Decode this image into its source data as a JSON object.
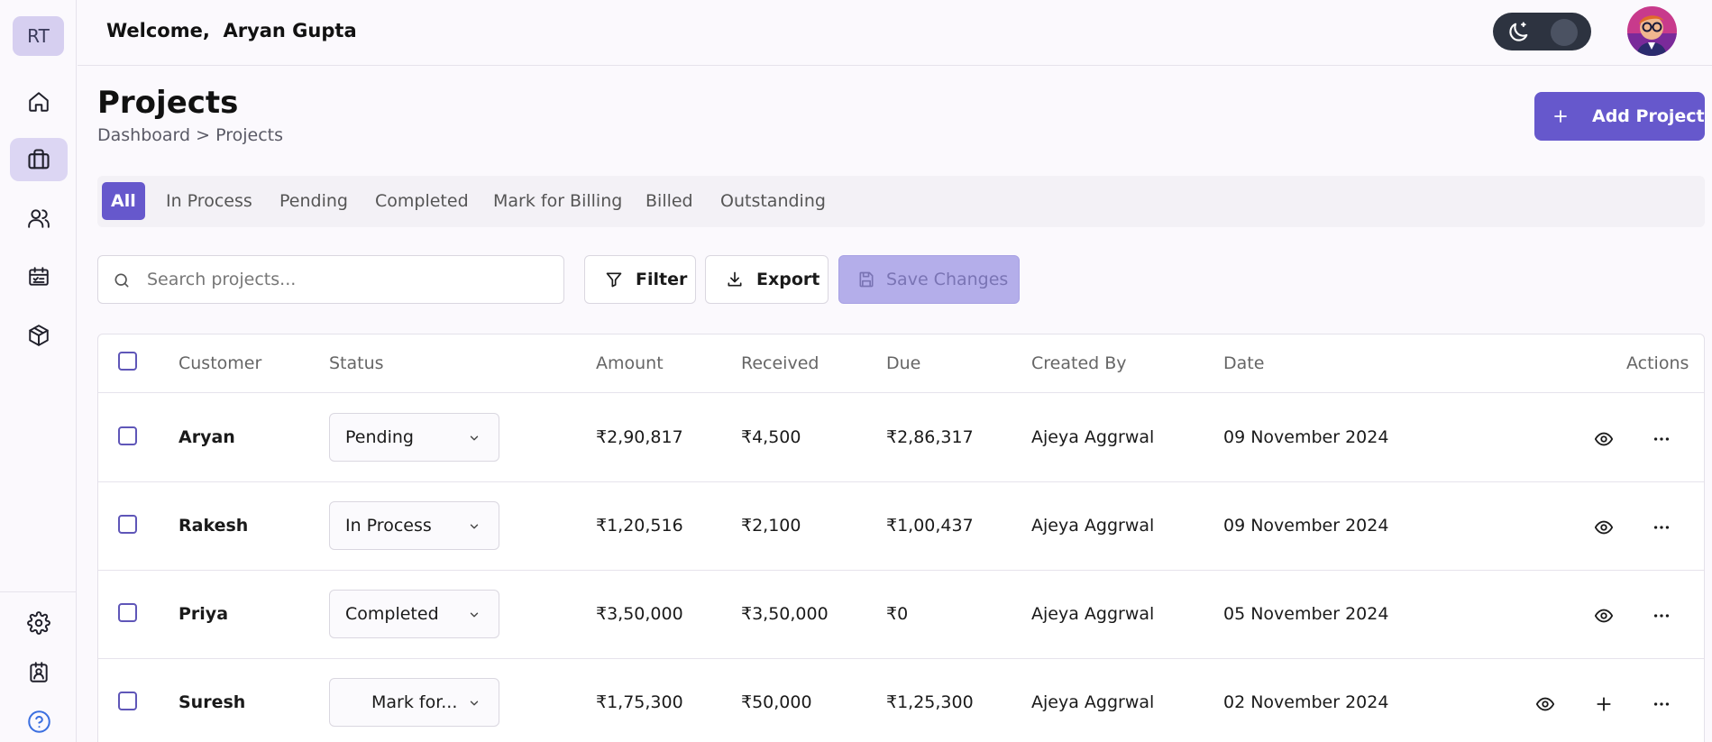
{
  "sidebar": {
    "logo": "RT",
    "items": [
      {
        "icon": "home-icon"
      },
      {
        "icon": "briefcase-icon",
        "active": true
      },
      {
        "icon": "users-icon"
      },
      {
        "icon": "calendar-check-icon"
      },
      {
        "icon": "package-icon"
      }
    ],
    "bottom_items": [
      {
        "icon": "settings-icon"
      },
      {
        "icon": "contact-card-icon"
      },
      {
        "icon": "help-icon"
      }
    ]
  },
  "header": {
    "welcome": "Welcome,  Aryan Gupta",
    "theme_toggle_icon": "moon-icon"
  },
  "page": {
    "title": "Projects",
    "breadcrumb": "Dashboard > Projects",
    "add_button": "Add Project"
  },
  "tabs": [
    {
      "label": "All",
      "active": true
    },
    {
      "label": "In Process"
    },
    {
      "label": "Pending"
    },
    {
      "label": "Completed"
    },
    {
      "label": "Mark for Billing"
    },
    {
      "label": "Billed"
    },
    {
      "label": "Outstanding"
    }
  ],
  "toolbar": {
    "search_placeholder": "Search projects...",
    "filter_label": "Filter",
    "export_label": "Export",
    "save_label": "Save Changes"
  },
  "table": {
    "columns": [
      "Customer",
      "Status",
      "Amount",
      "Received",
      "Due",
      "Created By",
      "Date",
      "Actions"
    ],
    "rows": [
      {
        "customer": "Aryan",
        "status": "Pending",
        "amount": "₹2,90,817",
        "received": "₹4,500",
        "due": "₹2,86,317",
        "created_by": "Ajeya Aggrwal",
        "date": "09 November 2024"
      },
      {
        "customer": "Rakesh",
        "status": "In Process",
        "amount": "₹1,20,516",
        "received": "₹2,100",
        "due": "₹1,00,437",
        "created_by": "Ajeya Aggrwal",
        "date": "09 November 2024"
      },
      {
        "customer": "Priya",
        "status": "Completed",
        "amount": "₹3,50,000",
        "received": "₹3,50,000",
        "due": "₹0",
        "created_by": "Ajeya Aggrwal",
        "date": "05 November 2024"
      },
      {
        "customer": "Suresh",
        "status": "Mark for...",
        "amount": "₹1,75,300",
        "received": "₹50,000",
        "due": "₹1,25,300",
        "created_by": "Ajeya Aggrwal",
        "date": "02 November 2024"
      }
    ]
  },
  "colors": {
    "accent": "#6658cc",
    "save_disabled": "#b4aeea",
    "logo_bg": "#d6cff0",
    "toggle_bg": "#2d3340"
  }
}
